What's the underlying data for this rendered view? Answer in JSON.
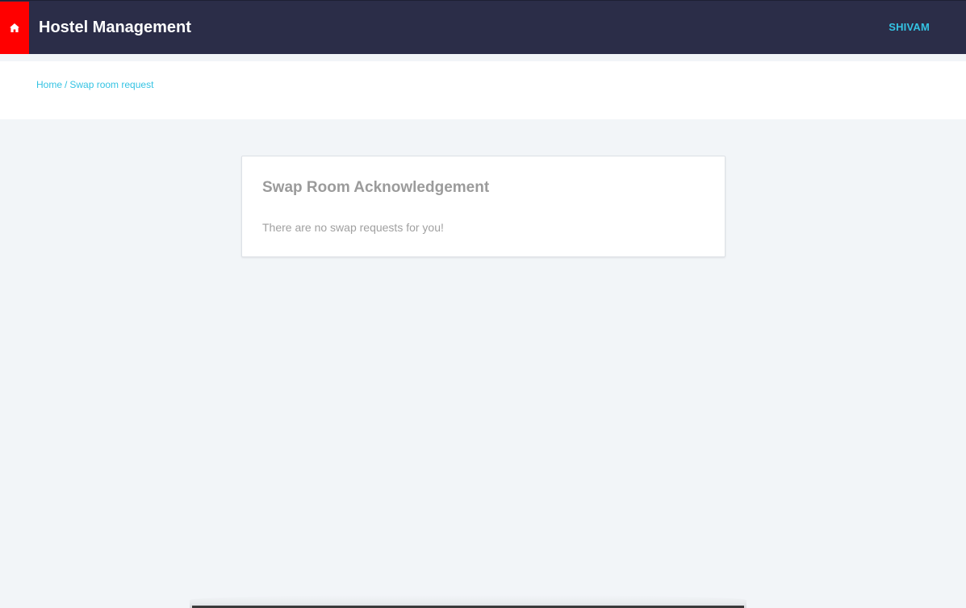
{
  "navbar": {
    "home_icon": "home-icon",
    "brand": "Hostel Management",
    "user": "SHIVAM"
  },
  "breadcrumb": {
    "home": "Home",
    "separator": "/",
    "current": "Swap room request"
  },
  "card": {
    "title": "Swap Room Acknowledgement",
    "message": "There are no swap requests for you!"
  },
  "colors": {
    "navbar_bg": "#2b2d48",
    "home_button_bg": "#ff0000",
    "accent": "#34c3e3",
    "page_bg": "#f2f5f8",
    "card_text": "#9b9b9b"
  }
}
